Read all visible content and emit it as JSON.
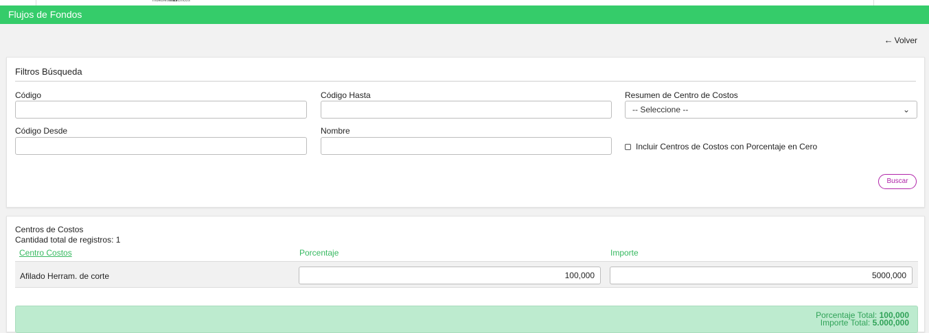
{
  "brand": {
    "logo_prefix": "muebles",
    "logo_bold": "mas",
    "logo_suffix": "chicos"
  },
  "header": {
    "title": "Flujos de Fondos"
  },
  "nav": {
    "back_label": "Volver",
    "back_icon": "arrow-left-icon"
  },
  "filters": {
    "title": "Filtros Búsqueda",
    "codigo": {
      "label": "Código",
      "value": ""
    },
    "codigo_hasta": {
      "label": "Código Hasta",
      "value": ""
    },
    "resumen": {
      "label": "Resumen de Centro de Costos",
      "selected": "-- Seleccione --"
    },
    "codigo_desde": {
      "label": "Código Desde",
      "value": ""
    },
    "nombre": {
      "label": "Nombre",
      "value": ""
    },
    "incluir_cero": {
      "label": "Incluir Centros de Costos con Porcentaje en Cero",
      "checked": false
    },
    "buscar_label": "Buscar"
  },
  "results": {
    "title": "Centros de Costos",
    "count_text": "Cantidad total de registros: 1",
    "columns": [
      "Centro Costos",
      "Porcentaje",
      "Importe"
    ],
    "rows": [
      {
        "centro": "Afilado Herram. de corte",
        "porcentaje": "100,000",
        "importe": "5000,000"
      }
    ],
    "totals": {
      "porcentaje_label": "Porcentaje Total:",
      "porcentaje_value": "100,000",
      "importe_label": "Importe Total:",
      "importe_value": "5.000,000"
    }
  },
  "colors": {
    "header_green": "#35cc6a",
    "accent_magenta": "#b022a8",
    "column_green": "#35b85f",
    "totals_bg": "#bdebcf"
  }
}
